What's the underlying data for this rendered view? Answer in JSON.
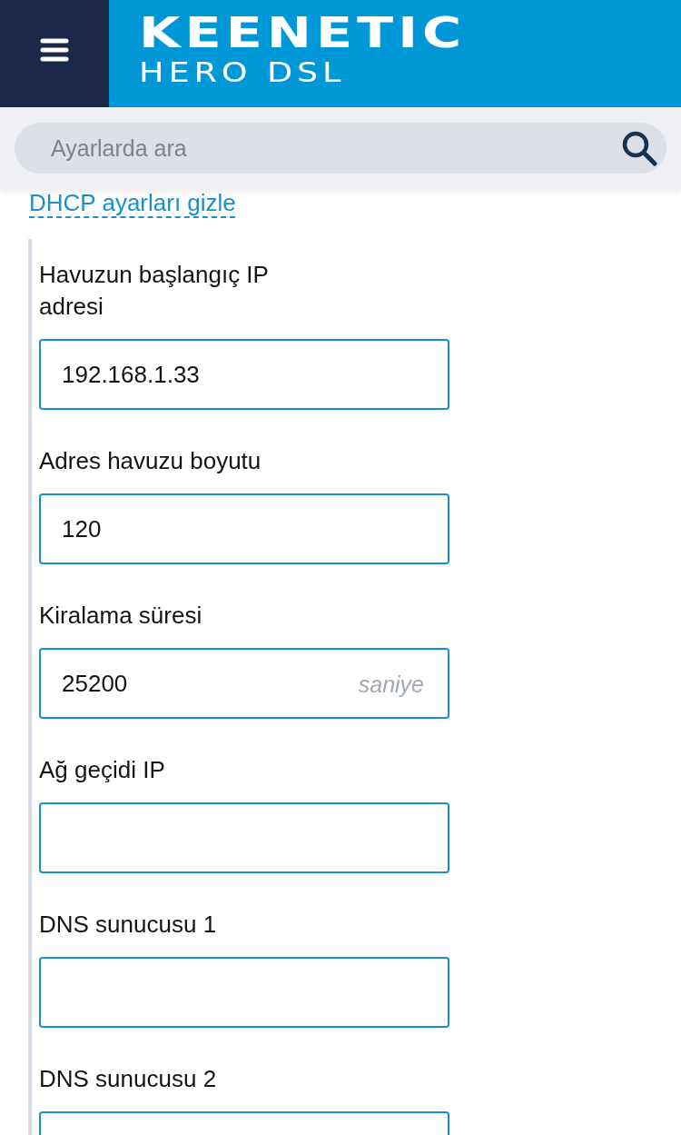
{
  "header": {
    "brand": "KEENETIC",
    "model": "HERO DSL"
  },
  "search": {
    "placeholder": "Ayarlarda ara"
  },
  "dhcp_toggle_link": "DHCP ayarları gizle",
  "fields": [
    {
      "label": "Havuzun başlangıç IP adresi",
      "value": "192.168.1.33"
    },
    {
      "label": "Adres havuzu boyutu",
      "value": "120"
    },
    {
      "label": "Kiralama süresi",
      "value": "25200",
      "unit": "saniye"
    },
    {
      "label": "Ağ geçidi IP"
    },
    {
      "label": "DNS sunucusu 1"
    },
    {
      "label": "DNS sunucusu 2"
    }
  ]
}
